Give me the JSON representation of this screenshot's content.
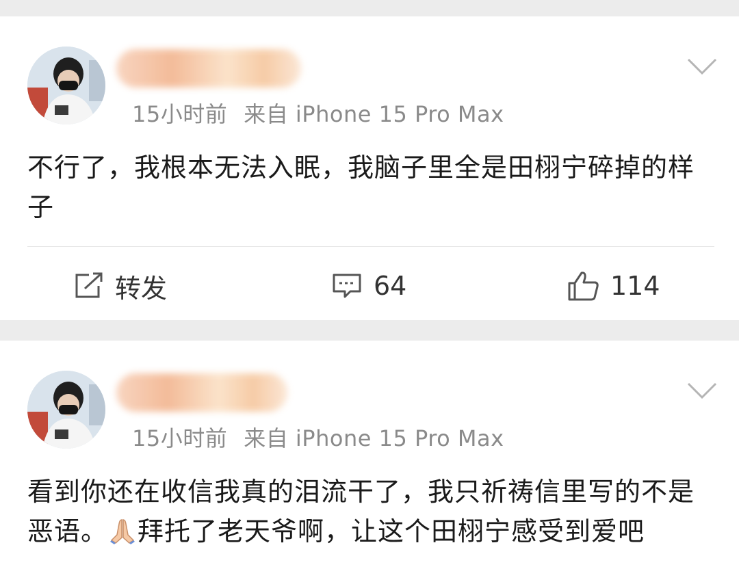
{
  "posts": [
    {
      "time": "15小时前",
      "source": "来自 iPhone 15 Pro Max",
      "text": "不行了，我根本无法入眠，我脑子里全是田栩宁碎掉的样子",
      "actions": {
        "repost_label": "转发",
        "comment_count": "64",
        "like_count": "114"
      }
    },
    {
      "time": "15小时前",
      "source": "来自 iPhone 15 Pro Max",
      "text_part1": "看到你还在收信我真的泪流干了，我只祈祷信里写的不是恶语。",
      "emoji": "praying-hands-icon",
      "text_part2": "拜托了老天爷啊，让这个田栩宁感受到爱吧"
    }
  ],
  "colors": {
    "background": "#ececec",
    "card": "#ffffff",
    "meta_text": "#8a8a8a",
    "body_text": "#1a1a1a"
  }
}
